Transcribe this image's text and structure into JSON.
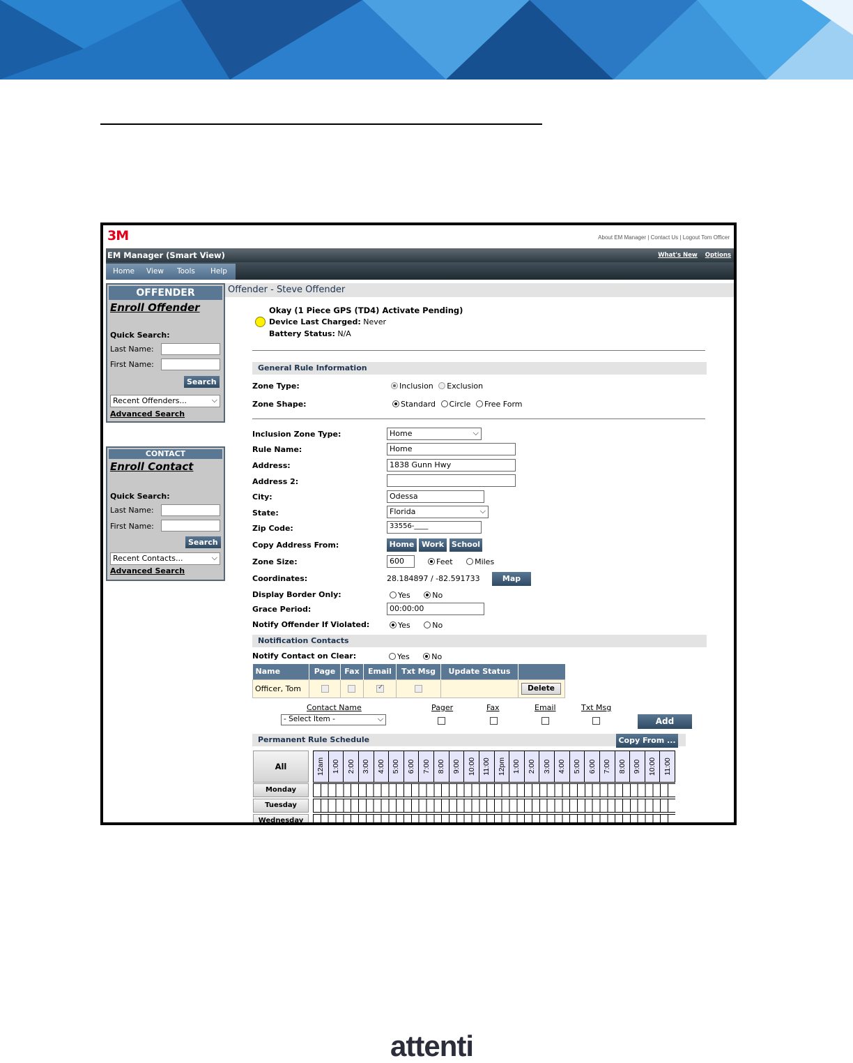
{
  "doc_footer": {
    "brand_text": "attenti"
  },
  "app": {
    "logo": "3M",
    "top_links": "About EM Manager | Contact Us | Logout Tom Officer",
    "title": "EM Manager (Smart View)",
    "whats_new": "What's New",
    "options": "Options",
    "nav": [
      "Home",
      "View",
      "Tools",
      "Help"
    ]
  },
  "offender_panel": {
    "header": "OFFENDER",
    "enroll": "Enroll Offender",
    "quick_search": "Quick Search:",
    "last_name_label": "Last Name:",
    "first_name_label": "First Name:",
    "search_button": "Search",
    "recent": "Recent Offenders...",
    "advanced": "Advanced Search"
  },
  "contact_panel": {
    "header": "CONTACT",
    "enroll": "Enroll Contact",
    "quick_search": "Quick Search:",
    "last_name_label": "Last Name:",
    "first_name_label": "First Name:",
    "search_button": "Search",
    "recent": "Recent Contacts...",
    "advanced": "Advanced Search"
  },
  "main": {
    "offender_title": "Offender - Steve Offender",
    "status_line": "Okay (1 Piece GPS (TD4) Activate Pending)",
    "charged_label": "Device Last Charged:",
    "charged_value": "Never",
    "battery_label": "Battery Status:",
    "battery_value": "N/A",
    "status_color": "#fff200",
    "general_section": "General Rule Information",
    "zone_type_label": "Zone Type:",
    "zone_type_options": [
      "Inclusion",
      "Exclusion"
    ],
    "zone_shape_label": "Zone Shape:",
    "zone_shape_options": [
      "Standard",
      "Circle",
      "Free Form"
    ],
    "inclusion_zone_type_label": "Inclusion Zone Type:",
    "inclusion_zone_type_value": "Home",
    "rule_name_label": "Rule Name:",
    "rule_name_value": "Home",
    "address_label": "Address:",
    "address_value": "1838 Gunn Hwy",
    "address2_label": "Address 2:",
    "address2_value": "",
    "city_label": "City:",
    "city_value": "Odessa",
    "state_label": "State:",
    "state_value": "Florida",
    "zip_label": "Zip Code:",
    "zip_value": "33556-____",
    "copy_label": "Copy Address From:",
    "copy_buttons": [
      "Home",
      "Work",
      "School"
    ],
    "zone_size_label": "Zone Size:",
    "zone_size_value": "600",
    "zone_units": [
      "Feet",
      "Miles"
    ],
    "coordinates_label": "Coordinates:",
    "coordinates_value": "28.184897 / -82.591733",
    "map_button": "Map",
    "border_label": "Display Border Only:",
    "grace_label": "Grace Period:",
    "grace_value": "00:00:00",
    "notify_offender_label": "Notify Offender If Violated:",
    "yes": "Yes",
    "no": "No",
    "notification_section": "Notification Contacts",
    "notify_clear_label": "Notify Contact on Clear:",
    "table_headers": [
      "Name",
      "Page",
      "Fax",
      "Email",
      "Txt Msg",
      "Update Status"
    ],
    "contact_row_name": "Officer, Tom",
    "delete_button": "Delete",
    "add_labels": [
      "Contact Name",
      "Pager",
      "Fax",
      "Email",
      "Txt Msg"
    ],
    "select_item": "- Select Item -",
    "add_button": "Add",
    "schedule_section": "Permanent Rule Schedule",
    "copy_from_button": "Copy From ...",
    "all_button": "All",
    "days": [
      "Monday",
      "Tuesday",
      "Wednesday"
    ],
    "hours": [
      "12am",
      "1:00",
      "2:00",
      "3:00",
      "4:00",
      "5:00",
      "6:00",
      "7:00",
      "8:00",
      "9:00",
      "10:00",
      "11:00",
      "12pm",
      "1:00",
      "2:00",
      "3:00",
      "4:00",
      "5:00",
      "6:00",
      "7:00",
      "8:00",
      "9:00",
      "10:00",
      "11:00"
    ]
  }
}
